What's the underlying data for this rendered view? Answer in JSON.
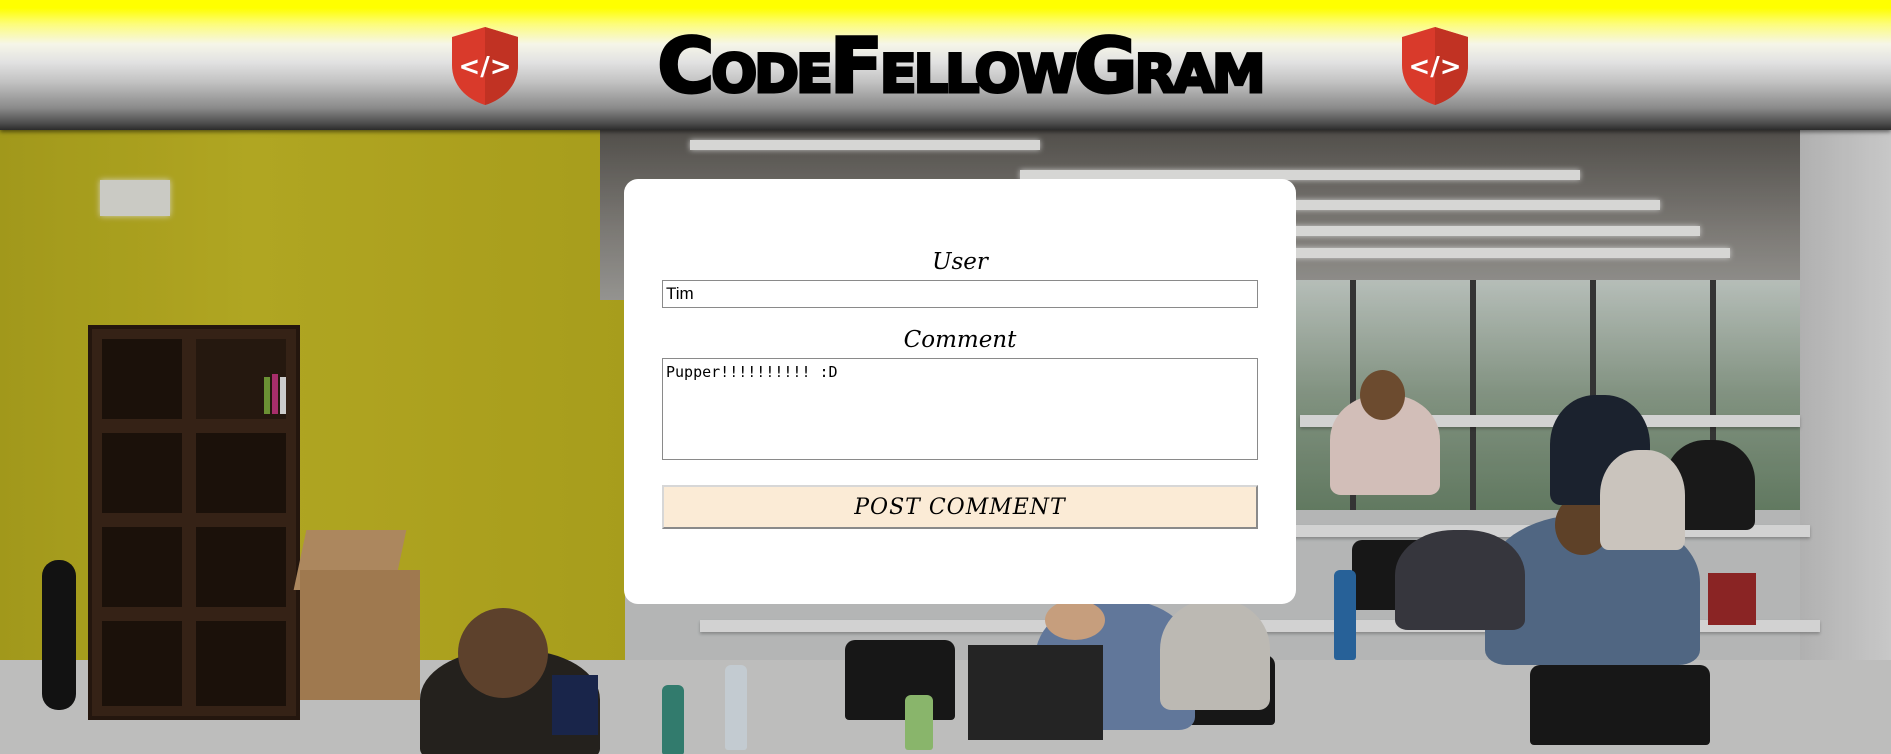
{
  "header": {
    "title": "CodeFellowGram",
    "accent_color": "#ffff00",
    "shield_color": "#d93a2b",
    "shield_symbol": "</>",
    "shield_icon": "code-shield-icon"
  },
  "form": {
    "user_label": "User",
    "user_value": "Tim",
    "comment_label": "Comment",
    "comment_value": "Pupper!!!!!!!!!! :D",
    "submit_label": "POST COMMENT",
    "submit_color": "#fbebd6"
  },
  "background": {
    "description_icon": "office-photo-background"
  }
}
